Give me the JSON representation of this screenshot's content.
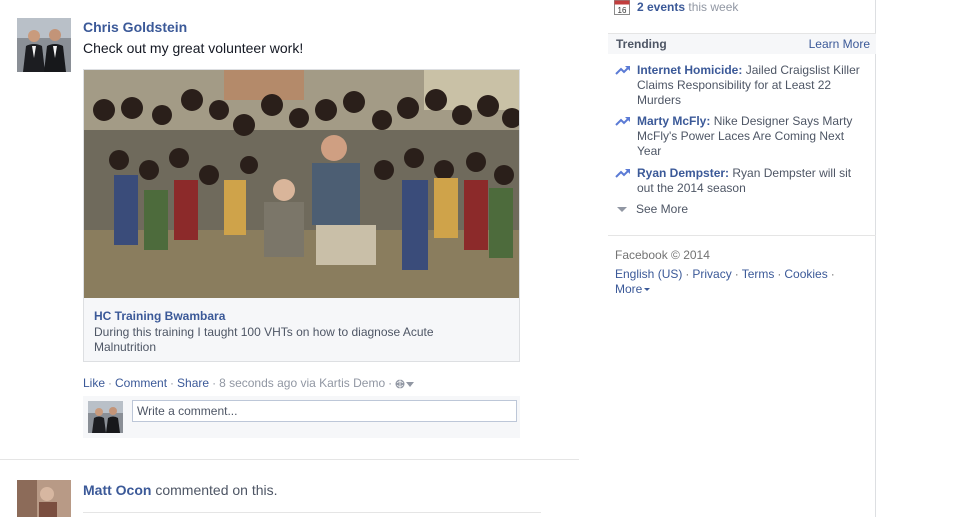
{
  "post": {
    "author": "Chris Goldstein",
    "text": "Check out my great volunteer work!",
    "attachment": {
      "title": "HC Training Bwambara",
      "description": "During this training I taught 100 VHTs on how to diagnose Acute Malnutrition"
    },
    "actions": {
      "like": "Like",
      "comment": "Comment",
      "share": "Share",
      "timestamp": "8 seconds ago via Kartis Demo"
    },
    "comment_placeholder": "Write a comment..."
  },
  "next_story": {
    "author": "Matt Ocon",
    "text": "commented on this."
  },
  "sidebar": {
    "events": {
      "count_label": "2 events",
      "suffix": "this week",
      "calendar_day": "16"
    },
    "trending": {
      "title": "Trending",
      "learn_more": "Learn More",
      "items": [
        {
          "topic": "Internet Homicide:",
          "text": "Jailed Craigslist Killer Claims Responsibility for at Least 22 Murders"
        },
        {
          "topic": "Marty McFly:",
          "text": "Nike Designer Says Marty McFly's Power Laces Are Coming Next Year"
        },
        {
          "topic": "Ryan Dempster:",
          "text": "Ryan Dempster will sit out the 2014 season"
        }
      ],
      "see_more": "See More"
    },
    "footer": {
      "copyright": "Facebook © 2014",
      "links": [
        "English (US)",
        "Privacy",
        "Terms",
        "Cookies"
      ],
      "more": "More"
    }
  },
  "colors": {
    "link": "#3b5998",
    "muted": "#9197a3",
    "text": "#141823",
    "panel": "#f6f7f9"
  }
}
